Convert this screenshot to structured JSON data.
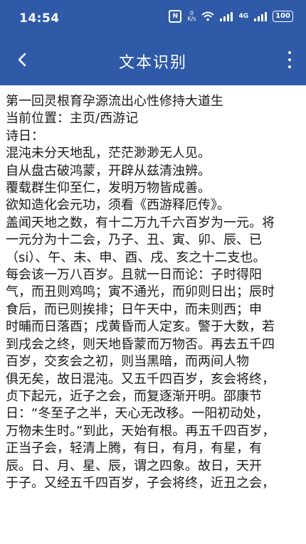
{
  "status": {
    "time": "14:54",
    "net_speed_value": "0",
    "net_speed_unit": "K/s",
    "network": "4G",
    "battery": "100",
    "icons": [
      "nfc-icon",
      "wifi-icon",
      "signal-icon",
      "battery-icon"
    ]
  },
  "toolbar": {
    "title": "文本识别",
    "back_icon": "arrow-back-icon",
    "more_icon": "more-vert-icon"
  },
  "colors": {
    "appbar": "#2f5aa8",
    "text": "#1a1a1a",
    "background": "#ffffff"
  },
  "content": {
    "lines": [
      "第一回灵根育孕源流出心性修持大道生",
      "当前位置：主页/西游记",
      "诗日：",
      "混沌未分天地乱，茫茫渺渺无人见。",
      "自从盘古破鸿蒙，开辟从兹清浊辨。",
      "覆载群生仰至仁，发明万物皆成善。",
      "欲知造化会元功，须看《西游释厄传》。",
      "盖闻天地之数，有十二万九千六百岁为一元。将",
      "一元分为十二会，乃子、丑、寅、卯、辰、已",
      "（si）、午、未、申、酉、戌、亥之十二支也。",
      "每会该一万八百岁。且就一日而论：子时得阳",
      "气，而丑则鸡鸣；寅不通光，而卯则日出；辰时",
      "食后，而已则挨排；日午天中，而未则西；申",
      "时晡而日落酉；戌黄昏而人定亥。警于大数，若",
      "到戌会之终，则天地昏蒙而万物否。再去五千四",
      "百岁，交亥会之初，则当黑暗，而两间人物",
      "俱无矣，故日混沌。又五千四百岁，亥会将终，",
      "贞下起元，近子之会，而复逐渐开明。邵康节",
      "日：“冬至子之半，天心无改移。一阳初动处，",
      "万物未生时。”到此，天始有根。再五千四百岁，",
      "正当子会，轻清上腾，有日，有月，有星，有",
      "辰。日、月、星、辰，谓之四象。故日，天开",
      "于子。又经五千四百岁，子会将终，近丑之会，"
    ]
  }
}
